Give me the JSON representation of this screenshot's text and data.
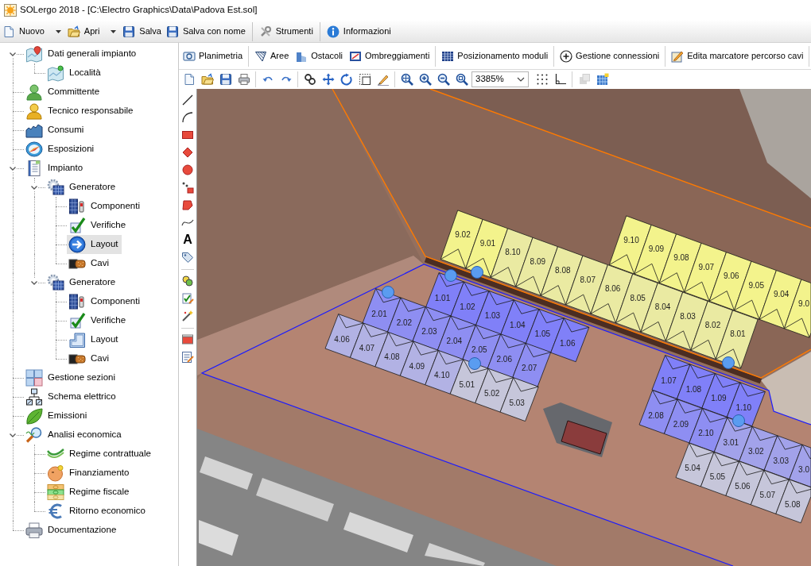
{
  "window": {
    "title": "SOLergo 2018 - [C:\\Electro Graphics\\Data\\Padova Est.sol]"
  },
  "toolbar": [
    {
      "label": "Nuovo",
      "dropdown": true
    },
    {
      "label": "Apri",
      "dropdown": true
    },
    {
      "label": "Salva",
      "dropdown": false
    },
    {
      "label": "Salva con nome",
      "dropdown": false
    },
    {
      "label": "Strumenti",
      "dropdown": false
    },
    {
      "label": "Informazioni",
      "dropdown": false
    }
  ],
  "tree": [
    {
      "label": "Dati generali impianto",
      "expanded": true,
      "selected": false,
      "children": [
        {
          "label": "Località",
          "selected": false
        }
      ]
    },
    {
      "label": "Committente",
      "selected": false
    },
    {
      "label": "Tecnico responsabile",
      "selected": false
    },
    {
      "label": "Consumi",
      "selected": false
    },
    {
      "label": "Esposizioni",
      "selected": false
    },
    {
      "label": "Impianto",
      "expanded": true,
      "selected": false,
      "children": [
        {
          "label": "Generatore",
          "expanded": true,
          "selected": false,
          "children": [
            {
              "label": "Componenti",
              "selected": false
            },
            {
              "label": "Verifiche",
              "selected": false
            },
            {
              "label": "Layout",
              "selected": true
            },
            {
              "label": "Cavi",
              "selected": false
            }
          ]
        },
        {
          "label": "Generatore",
          "expanded": true,
          "selected": false,
          "children": [
            {
              "label": "Componenti",
              "selected": false
            },
            {
              "label": "Verifiche",
              "selected": false
            },
            {
              "label": "Layout",
              "selected": false
            },
            {
              "label": "Cavi",
              "selected": false
            }
          ]
        }
      ]
    },
    {
      "label": "Gestione sezioni",
      "selected": false
    },
    {
      "label": "Schema elettrico",
      "selected": false
    },
    {
      "label": "Emissioni",
      "selected": false
    },
    {
      "label": "Analisi economica",
      "expanded": true,
      "selected": false,
      "children": [
        {
          "label": "Regime contrattuale",
          "selected": false
        },
        {
          "label": "Finanziamento",
          "selected": false
        },
        {
          "label": "Regime fiscale",
          "selected": false
        },
        {
          "label": "Ritorno economico",
          "selected": false
        }
      ]
    },
    {
      "label": "Documentazione",
      "selected": false
    }
  ],
  "mode_bar": [
    {
      "label": "Planimetria"
    },
    {
      "label": "Aree"
    },
    {
      "label": "Ostacoli"
    },
    {
      "label": "Ombreggiamenti"
    },
    {
      "label": "Posizionamento moduli"
    },
    {
      "label": "Gestione connessioni"
    },
    {
      "label": "Edita marcatore percorso cavi"
    }
  ],
  "view_toolbar": [
    {
      "disabled": false
    },
    {
      "disabled": false
    },
    {
      "disabled": false
    },
    {
      "disabled": false
    },
    {
      "disabled": false
    },
    {
      "disabled": false
    },
    {
      "disabled": false
    },
    {
      "disabled": false
    },
    {
      "disabled": false
    },
    {
      "disabled": false
    },
    {
      "disabled": false
    },
    {
      "disabled": false
    },
    {
      "disabled": false
    },
    {
      "disabled": false
    },
    {
      "disabled": false
    },
    {
      "disabled": false
    },
    {
      "disabled": false
    },
    {
      "disabled": true
    },
    {
      "disabled": false
    }
  ],
  "zoom_combo": {
    "value": "3385%"
  },
  "side_toolbar": {
    "text_tool": "A"
  },
  "module_rows": [
    {
      "modules": [
        {
          "label": "9.10",
          "color": "#f3f38c"
        },
        {
          "label": "9.09",
          "color": "#f3f38c"
        },
        {
          "label": "9.08",
          "color": "#f3f38c"
        },
        {
          "label": "9.07",
          "color": "#f3f38c"
        },
        {
          "label": "9.06",
          "color": "#f3f38c"
        },
        {
          "label": "9.05",
          "color": "#f3f38c"
        },
        {
          "label": "9.04",
          "color": "#f3f38c"
        },
        {
          "label": "9.0",
          "color": "#f3f38c"
        }
      ]
    },
    {
      "modules": [
        {
          "label": "9.02",
          "color": "#f3f38c"
        },
        {
          "label": "9.01",
          "color": "#f3f38c"
        },
        {
          "label": "8.10",
          "color": "#eaeaa2"
        },
        {
          "label": "8.09",
          "color": "#eaeaa2"
        },
        {
          "label": "8.08",
          "color": "#eaeaa2"
        },
        {
          "label": "8.07",
          "color": "#eaeaa2"
        },
        {
          "label": "8.06",
          "color": "#eaeaa2"
        },
        {
          "label": "8.05",
          "color": "#eaeaa2"
        },
        {
          "label": "8.04",
          "color": "#eaeaa2"
        },
        {
          "label": "8.03",
          "color": "#eaeaa2"
        },
        {
          "label": "8.02",
          "color": "#eaeaa2"
        },
        {
          "label": "8.01",
          "color": "#eaeaa2"
        }
      ]
    },
    {
      "modules": [
        {
          "label": "1.01",
          "color": "#8080f8"
        },
        {
          "label": "1.02",
          "color": "#8080f8"
        },
        {
          "label": "1.03",
          "color": "#8080f8"
        },
        {
          "label": "1.04",
          "color": "#8080f8"
        },
        {
          "label": "1.05",
          "color": "#8080f8"
        },
        {
          "label": "1.06",
          "color": "#8080f8"
        }
      ]
    },
    {
      "modules": [
        {
          "label": "2.01",
          "color": "#8e8ef2"
        },
        {
          "label": "2.02",
          "color": "#8e8ef2"
        },
        {
          "label": "2.03",
          "color": "#8e8ef2"
        },
        {
          "label": "2.04",
          "color": "#8e8ef2"
        },
        {
          "label": "2.05",
          "color": "#8e8ef2"
        },
        {
          "label": "2.06",
          "color": "#8e8ef2"
        },
        {
          "label": "2.07",
          "color": "#8e8ef2"
        }
      ]
    },
    {
      "modules": [
        {
          "label": "4.06",
          "color": "#b2b2e4"
        },
        {
          "label": "4.07",
          "color": "#b2b2e4"
        },
        {
          "label": "4.08",
          "color": "#b2b2e4"
        },
        {
          "label": "4.09",
          "color": "#b2b2e4"
        },
        {
          "label": "4.10",
          "color": "#b2b2e4"
        },
        {
          "label": "5.01",
          "color": "#c6c6da"
        },
        {
          "label": "5.02",
          "color": "#c6c6da"
        },
        {
          "label": "5.03",
          "color": "#c6c6da"
        }
      ]
    },
    {
      "modules": [
        {
          "label": "1.07",
          "color": "#8080f8"
        },
        {
          "label": "1.08",
          "color": "#8080f8"
        },
        {
          "label": "1.09",
          "color": "#8080f8"
        },
        {
          "label": "1.10",
          "color": "#8080f8"
        }
      ]
    },
    {
      "modules": [
        {
          "label": "2.08",
          "color": "#8e8ef2"
        },
        {
          "label": "2.09",
          "color": "#8e8ef2"
        },
        {
          "label": "2.10",
          "color": "#8e8ef2"
        },
        {
          "label": "3.01",
          "color": "#a2a2ea"
        },
        {
          "label": "3.02",
          "color": "#a2a2ea"
        },
        {
          "label": "3.03",
          "color": "#a2a2ea"
        },
        {
          "label": "3.0",
          "color": "#a2a2ea"
        }
      ]
    },
    {
      "modules": [
        {
          "label": "5.04",
          "color": "#c6c6da"
        },
        {
          "label": "5.05",
          "color": "#c6c6da"
        },
        {
          "label": "5.06",
          "color": "#c6c6da"
        },
        {
          "label": "5.07",
          "color": "#c6c6da"
        },
        {
          "label": "5.08",
          "color": "#c6c6da"
        }
      ]
    }
  ]
}
